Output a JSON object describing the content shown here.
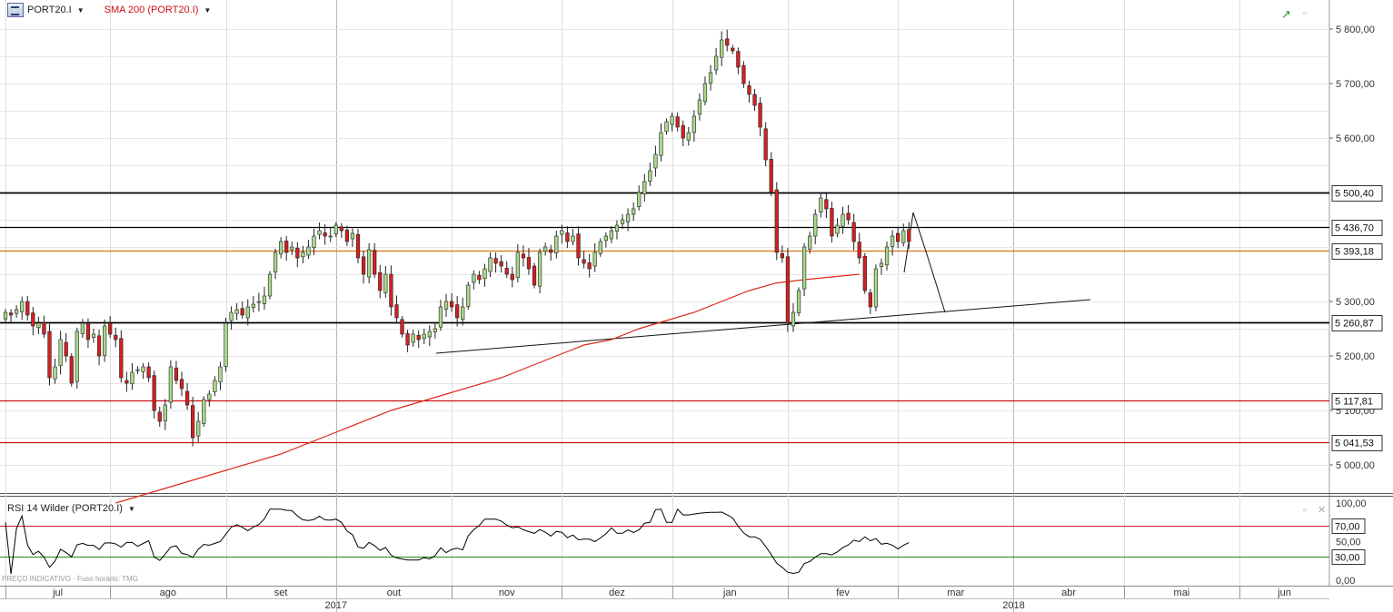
{
  "header": {
    "symbol": "PORT20.I",
    "indicator": "SMA 200 (PORT20.I)",
    "rsi_label": "RSI 14 Wilder (PORT20.I)",
    "footer": "PREÇO INDICATIVO · Fuso horário: TMG"
  },
  "colors": {
    "up_candle": "#a8d98a",
    "down_candle": "#d42020",
    "sma": "#dd2a1a",
    "black_level": "#000000",
    "orange_level": "#e07010",
    "red_level": "#cc1010",
    "rsi_line": "#000000",
    "rsi_upper": "#cc2020",
    "rsi_lower": "#1a8a1a"
  },
  "icons": [
    "trend-up-icon",
    "window-icon",
    "close-icon",
    "dropdown-caret-icon"
  ],
  "chart_data": {
    "type": "candlestick",
    "price_axis": {
      "range": [
        4950,
        5840
      ],
      "ticks": [
        "5 000,00",
        "5 100,00",
        "5 200,00",
        "5 300,00",
        "5 600,00",
        "5 700,00",
        "5 800,00"
      ],
      "tick_values": [
        5000,
        5100,
        5200,
        5300,
        5600,
        5700,
        5800
      ]
    },
    "level_labels": [
      {
        "text": "5 500,40",
        "value": 5500.4,
        "color": "black"
      },
      {
        "text": "5 436,70",
        "value": 5436.7,
        "color": "black"
      },
      {
        "text": "5 393,18",
        "value": 5393.18,
        "color": "orange"
      },
      {
        "text": "5 260,87",
        "value": 5260.87,
        "color": "black"
      },
      {
        "text": "5 117,81",
        "value": 5117.81,
        "color": "red"
      },
      {
        "text": "5 041,53",
        "value": 5041.53,
        "color": "red"
      }
    ],
    "time_axis": {
      "months": [
        "jul",
        "ago",
        "set",
        "out",
        "nov",
        "dez",
        "jan",
        "fev",
        "mar",
        "abr",
        "mai",
        "jun"
      ],
      "years": [
        "2017",
        "2018"
      ],
      "month_start_index": [
        0,
        19,
        40,
        60,
        81,
        101,
        121,
        142,
        162,
        183,
        203,
        224
      ],
      "year_index": [
        60,
        183
      ],
      "total_sessions": 240
    },
    "candles_close": [
      5280,
      5275,
      5285,
      5300,
      5275,
      5255,
      5260,
      5240,
      5160,
      5180,
      5230,
      5200,
      5150,
      5245,
      5260,
      5230,
      5240,
      5200,
      5255,
      5240,
      5230,
      5160,
      5150,
      5170,
      5175,
      5180,
      5160,
      5100,
      5080,
      5110,
      5180,
      5155,
      5140,
      5110,
      5050,
      5080,
      5120,
      5130,
      5155,
      5180,
      5260,
      5280,
      5285,
      5275,
      5290,
      5295,
      5300,
      5310,
      5350,
      5390,
      5410,
      5390,
      5400,
      5380,
      5390,
      5400,
      5420,
      5430,
      5420,
      5420,
      5440,
      5430,
      5410,
      5425,
      5380,
      5350,
      5395,
      5350,
      5320,
      5350,
      5290,
      5270,
      5240,
      5220,
      5240,
      5230,
      5240,
      5245,
      5250,
      5290,
      5300,
      5290,
      5270,
      5290,
      5330,
      5350,
      5340,
      5360,
      5380,
      5370,
      5365,
      5350,
      5340,
      5390,
      5380,
      5360,
      5330,
      5390,
      5400,
      5390,
      5420,
      5430,
      5410,
      5420,
      5380,
      5370,
      5360,
      5390,
      5410,
      5420,
      5430,
      5440,
      5450,
      5460,
      5470,
      5500,
      5520,
      5540,
      5570,
      5610,
      5630,
      5640,
      5620,
      5600,
      5610,
      5640,
      5670,
      5700,
      5720,
      5750,
      5780,
      5770,
      5760,
      5730,
      5700,
      5680,
      5660,
      5620,
      5560,
      5500,
      5390,
      5380,
      5260,
      5280,
      5320,
      5400,
      5420,
      5460,
      5490,
      5470,
      5420,
      5440,
      5460,
      5450,
      5410,
      5380,
      5320,
      5290,
      5360,
      5370,
      5400,
      5420,
      5410,
      5430,
      5410
    ],
    "sma_200": [
      4930,
      4960,
      4990,
      5020,
      5060,
      5100,
      5130,
      5160,
      5180,
      5200,
      5220,
      5230,
      5250,
      5265,
      5280,
      5300,
      5320,
      5334,
      5340,
      5345,
      5350
    ],
    "sma_index": [
      20,
      30,
      40,
      50,
      60,
      70,
      80,
      90,
      95,
      100,
      105,
      110,
      115,
      120,
      125,
      130,
      135,
      140,
      145,
      150,
      155
    ],
    "rsi": {
      "range": [
        0,
        100
      ],
      "ticks": [
        "0,00",
        "30,00",
        "50,00",
        "70,00",
        "100,00"
      ],
      "tick_values": [
        0,
        30,
        50,
        70,
        100
      ],
      "overbought": 70,
      "oversold": 30,
      "overbought_label": "70,00",
      "oversold_label": "30,00"
    }
  }
}
